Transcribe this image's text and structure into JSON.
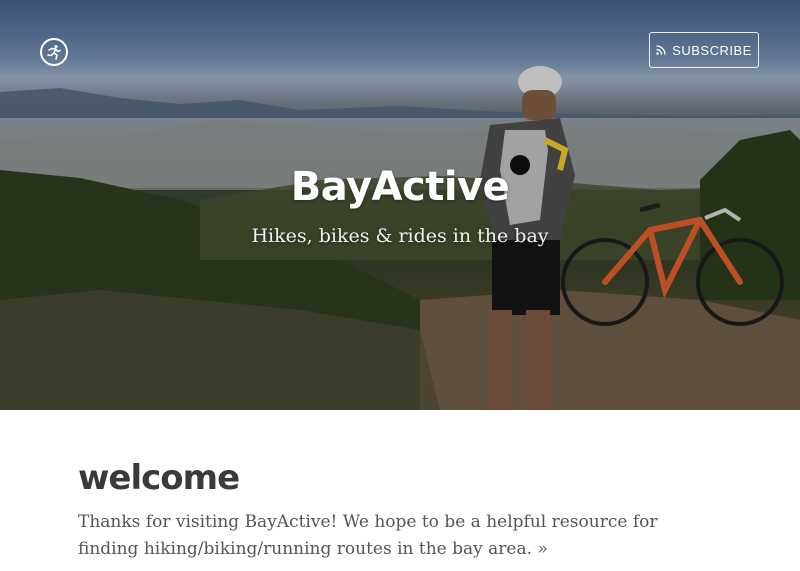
{
  "header": {
    "logo_icon": "runner-icon",
    "subscribe_icon": "rss-icon",
    "subscribe_label": "SUBSCRIBE",
    "site_title": "BayActive",
    "site_description": "Hikes, bikes & rides in the bay"
  },
  "post": {
    "title": "welcome",
    "excerpt": "Thanks for visiting BayActive! We hope to be a helpful resource for finding hiking/biking/running routes in the bay area.",
    "read_more": "»"
  },
  "colors": {
    "title_text": "#3a3a3a",
    "body_text": "#555555",
    "hero_text": "#ffffff"
  }
}
